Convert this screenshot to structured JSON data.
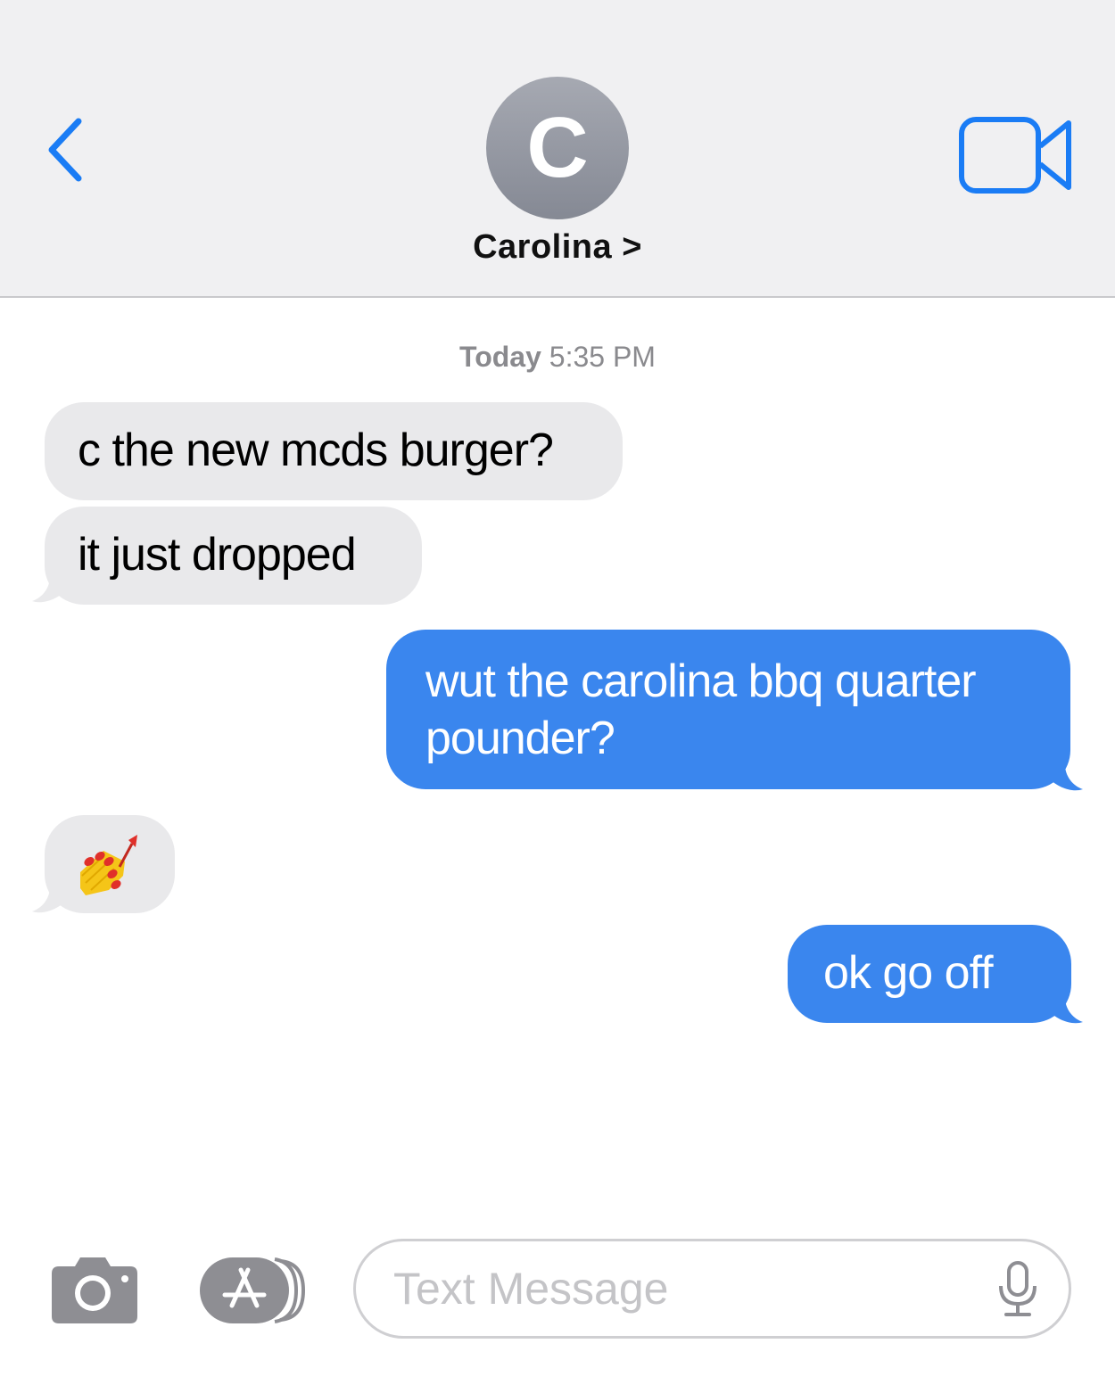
{
  "header": {
    "back_icon": "chevron-left-icon",
    "avatar_initial": "C",
    "contact_name": "Carolina >",
    "video_icon": "video-camera-icon",
    "accent_color": "#1a7cf5"
  },
  "timestamp": {
    "day": "Today",
    "time": "5:35 PM"
  },
  "messages": [
    {
      "direction": "incoming",
      "text": "c the new mcds burger?"
    },
    {
      "direction": "incoming",
      "text": "it just dropped"
    },
    {
      "direction": "outgoing",
      "text": "wut the carolina bbq quarter pounder?"
    },
    {
      "direction": "incoming",
      "emoji": "nail-polish-emoji"
    },
    {
      "direction": "outgoing",
      "text": "ok go off"
    }
  ],
  "colors": {
    "incoming_bubble": "#e9e9eb",
    "outgoing_bubble": "#3a86ee"
  },
  "input_bar": {
    "camera_icon": "camera-icon",
    "apps_icon": "app-store-icon",
    "placeholder": "Text Message",
    "mic_icon": "microphone-icon"
  }
}
